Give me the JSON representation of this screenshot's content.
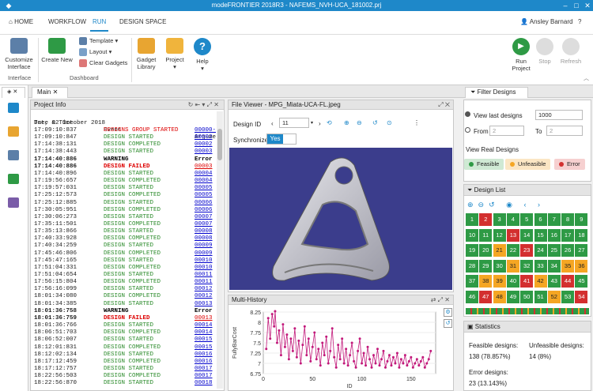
{
  "title": "modeFRONTIER 2018R3 - NAFEMS_NVH-UCA_181002.prj",
  "menu": {
    "home": "HOME",
    "workflow": "WORKFLOW",
    "run": "RUN",
    "design_space": "DESIGN SPACE",
    "user": "Ansley Barnard"
  },
  "ribbon": {
    "customize": "Customize Interface",
    "interface_group": "Interface",
    "create_new": "Create New",
    "template": "Template",
    "layout": "Layout",
    "clear_gadgets": "Clear Gadgets",
    "dashboard_group": "Dashboard",
    "gadget_library": "Gadget Library",
    "project": "Project",
    "help": "Help",
    "run_project": "Run Project",
    "stop": "Stop",
    "refresh": "Refresh"
  },
  "tabs": {
    "main": "Main"
  },
  "project_info": {
    "title": "Project Info",
    "headers": {
      "date": "Date & Time",
      "event": "Event",
      "arg": "Argumen"
    },
    "date_line": "Tue, 02 October 2018",
    "rows": [
      {
        "t": "17:09:10:837",
        "e": "DESIGNS GROUP STARTED",
        "a": "00000-0",
        "k": "group"
      },
      {
        "t": "17:09:10:847",
        "e": "DESIGN STARTED",
        "a": "00002",
        "k": "started"
      },
      {
        "t": "17:14:38:131",
        "e": "DESIGN COMPLETED",
        "a": "00002",
        "k": "completed"
      },
      {
        "t": "17:14:38:443",
        "e": "DESIGN STARTED",
        "a": "00003",
        "k": "started"
      },
      {
        "t": "17:14:40:886",
        "e": "WARNING",
        "a": "Error I",
        "k": "warning"
      },
      {
        "t": "17:14:40:886",
        "e": "DESIGN FAILED",
        "a": "00003",
        "k": "failed"
      },
      {
        "t": "17:14:40:896",
        "e": "DESIGN STARTED",
        "a": "00004",
        "k": "started"
      },
      {
        "t": "17:19:56:657",
        "e": "DESIGN COMPLETED",
        "a": "00004",
        "k": "completed"
      },
      {
        "t": "17:19:57:031",
        "e": "DESIGN STARTED",
        "a": "00005",
        "k": "started"
      },
      {
        "t": "17:25:12:573",
        "e": "DESIGN COMPLETED",
        "a": "00005",
        "k": "completed"
      },
      {
        "t": "17:25:12:885",
        "e": "DESIGN STARTED",
        "a": "00006",
        "k": "started"
      },
      {
        "t": "17:30:05:951",
        "e": "DESIGN COMPLETED",
        "a": "00006",
        "k": "completed"
      },
      {
        "t": "17:30:06:273",
        "e": "DESIGN STARTED",
        "a": "00007",
        "k": "started"
      },
      {
        "t": "17:35:11:501",
        "e": "DESIGN COMPLETED",
        "a": "00007",
        "k": "completed"
      },
      {
        "t": "17:35:13:866",
        "e": "DESIGN STARTED",
        "a": "00008",
        "k": "started"
      },
      {
        "t": "17:40:33:928",
        "e": "DESIGN COMPLETED",
        "a": "00008",
        "k": "completed"
      },
      {
        "t": "17:40:34:259",
        "e": "DESIGN STARTED",
        "a": "00009",
        "k": "started"
      },
      {
        "t": "17:45:46:806",
        "e": "DESIGN COMPLETED",
        "a": "00009",
        "k": "completed"
      },
      {
        "t": "17:45:47:165",
        "e": "DESIGN STARTED",
        "a": "00010",
        "k": "started"
      },
      {
        "t": "17:51:04:331",
        "e": "DESIGN COMPLETED",
        "a": "00010",
        "k": "completed"
      },
      {
        "t": "17:51:04:654",
        "e": "DESIGN STARTED",
        "a": "00011",
        "k": "started"
      },
      {
        "t": "17:56:15:804",
        "e": "DESIGN COMPLETED",
        "a": "00011",
        "k": "completed"
      },
      {
        "t": "17:56:16:099",
        "e": "DESIGN STARTED",
        "a": "00012",
        "k": "started"
      },
      {
        "t": "18:01:34:080",
        "e": "DESIGN COMPLETED",
        "a": "00012",
        "k": "completed"
      },
      {
        "t": "18:01:34:385",
        "e": "DESIGN STARTED",
        "a": "00013",
        "k": "started"
      },
      {
        "t": "18:01:36:758",
        "e": "WARNING",
        "a": "Error I",
        "k": "warning"
      },
      {
        "t": "18:01:36:759",
        "e": "DESIGN FAILED",
        "a": "00013",
        "k": "failed"
      },
      {
        "t": "18:01:36:766",
        "e": "DESIGN STARTED",
        "a": "00014",
        "k": "started"
      },
      {
        "t": "18:06:51:703",
        "e": "DESIGN COMPLETED",
        "a": "00014",
        "k": "completed"
      },
      {
        "t": "18:06:52:007",
        "e": "DESIGN STARTED",
        "a": "00015",
        "k": "started"
      },
      {
        "t": "18:12:01:831",
        "e": "DESIGN COMPLETED",
        "a": "00015",
        "k": "completed"
      },
      {
        "t": "18:12:02:134",
        "e": "DESIGN STARTED",
        "a": "00016",
        "k": "started"
      },
      {
        "t": "18:17:12:459",
        "e": "DESIGN COMPLETED",
        "a": "00016",
        "k": "completed"
      },
      {
        "t": "18:17:12:757",
        "e": "DESIGN STARTED",
        "a": "00017",
        "k": "started"
      },
      {
        "t": "18:22:56:503",
        "e": "DESIGN COMPLETED",
        "a": "00017",
        "k": "completed"
      },
      {
        "t": "18:22:56:870",
        "e": "DESIGN STARTED",
        "a": "00018",
        "k": "started"
      }
    ]
  },
  "file_viewer": {
    "title": "File Viewer - MPG_Miata-UCA-FL.jpeg",
    "design_id_label": "Design ID",
    "design_id": "11",
    "sync_label": "Synchronize",
    "sync_value": "Yes"
  },
  "multi_history": {
    "title": "Multi-History"
  },
  "chart_data": {
    "type": "line",
    "ylabel": "FullyBarCost",
    "xlabel": "ID",
    "ylim": [
      6.75,
      8.25
    ],
    "xlim": [
      0,
      175
    ],
    "yticks": [
      "8.25",
      "8",
      "7.75",
      "7.5",
      "7.25",
      "7",
      "6.75"
    ],
    "xticks": [
      "0",
      "50",
      "100",
      "150"
    ],
    "series": [
      {
        "values": [
          [
            3,
            7.35
          ],
          [
            5,
            8.1
          ],
          [
            7,
            7.6
          ],
          [
            9,
            8.2
          ],
          [
            11,
            7.9
          ],
          [
            12,
            8.27
          ],
          [
            14,
            7.5
          ],
          [
            16,
            7.8
          ],
          [
            18,
            7.2
          ],
          [
            20,
            7.95
          ],
          [
            22,
            7.4
          ],
          [
            24,
            7.7
          ],
          [
            26,
            7.1
          ],
          [
            28,
            7.6
          ],
          [
            30,
            7.3
          ],
          [
            32,
            7.85
          ],
          [
            34,
            7.15
          ],
          [
            36,
            7.55
          ],
          [
            38,
            7.0
          ],
          [
            40,
            7.45
          ],
          [
            42,
            7.9
          ],
          [
            44,
            7.2
          ],
          [
            46,
            7.6
          ],
          [
            48,
            7.05
          ],
          [
            50,
            7.4
          ],
          [
            52,
            7.75
          ],
          [
            54,
            7.1
          ],
          [
            56,
            7.35
          ],
          [
            58,
            6.95
          ],
          [
            60,
            7.5
          ],
          [
            62,
            7.2
          ],
          [
            64,
            7.65
          ],
          [
            66,
            7.0
          ],
          [
            68,
            7.3
          ],
          [
            70,
            7.85
          ],
          [
            72,
            7.15
          ],
          [
            74,
            6.9
          ],
          [
            76,
            7.45
          ],
          [
            78,
            7.1
          ],
          [
            80,
            7.6
          ],
          [
            82,
            7.0
          ],
          [
            84,
            7.35
          ],
          [
            86,
            6.95
          ],
          [
            88,
            7.2
          ],
          [
            90,
            7.5
          ],
          [
            92,
            7.05
          ],
          [
            94,
            6.9
          ],
          [
            96,
            7.3
          ],
          [
            98,
            7.6
          ],
          [
            100,
            7.0
          ],
          [
            102,
            7.25
          ],
          [
            104,
            6.95
          ],
          [
            106,
            7.4
          ],
          [
            108,
            7.1
          ],
          [
            110,
            6.9
          ],
          [
            112,
            7.2
          ],
          [
            114,
            7.0
          ],
          [
            116,
            7.35
          ],
          [
            118,
            6.95
          ],
          [
            120,
            7.1
          ],
          [
            122,
            7.3
          ],
          [
            124,
            6.9
          ],
          [
            126,
            7.05
          ],
          [
            128,
            7.2
          ],
          [
            130,
            6.95
          ],
          [
            132,
            7.15
          ],
          [
            134,
            7.0
          ],
          [
            136,
            7.25
          ],
          [
            138,
            6.9
          ],
          [
            140,
            7.1
          ],
          [
            142,
            7.0
          ],
          [
            144,
            7.2
          ],
          [
            146,
            6.95
          ],
          [
            148,
            7.05
          ],
          [
            150,
            7.15
          ],
          [
            152,
            6.9
          ],
          [
            154,
            7.0
          ],
          [
            156,
            7.1
          ],
          [
            158,
            6.95
          ],
          [
            160,
            7.05
          ],
          [
            162,
            7.15
          ],
          [
            164,
            6.9
          ],
          [
            166,
            7.0
          ],
          [
            168,
            7.1
          ],
          [
            170,
            7.3
          ]
        ]
      }
    ]
  },
  "filter": {
    "title": "Filter Designs",
    "view_last": "View last designs",
    "view_last_value": "1000",
    "from": "From",
    "from_value": "2",
    "to": "To",
    "to_value": "2",
    "view_real": "View Real Designs",
    "feasible": "Feasible",
    "unfeasible": "Unfeasible",
    "error": "Error"
  },
  "design_list": {
    "title": "Design List",
    "cells": [
      [
        "1",
        "2",
        "3",
        "4",
        "5",
        "6",
        "7",
        "8",
        "9"
      ],
      [
        "10",
        "11",
        "12",
        "13",
        "14",
        "15",
        "16",
        "17",
        "18"
      ],
      [
        "19",
        "20",
        "21",
        "22",
        "23",
        "24",
        "25",
        "26",
        "27"
      ],
      [
        "28",
        "29",
        "30",
        "31",
        "32",
        "33",
        "34",
        "35",
        "36"
      ],
      [
        "37",
        "38",
        "39",
        "40",
        "41",
        "42",
        "43",
        "44",
        "45"
      ],
      [
        "46",
        "47",
        "48",
        "49",
        "50",
        "51",
        "52",
        "53",
        "54"
      ]
    ],
    "status": [
      [
        "g",
        "r",
        "g",
        "g",
        "g",
        "g",
        "g",
        "g",
        "g"
      ],
      [
        "g",
        "g",
        "g",
        "r",
        "g",
        "g",
        "g",
        "g",
        "g"
      ],
      [
        "g",
        "g",
        "o",
        "g",
        "r",
        "g",
        "g",
        "g",
        "g"
      ],
      [
        "g",
        "g",
        "g",
        "o",
        "g",
        "g",
        "g",
        "o",
        "o"
      ],
      [
        "g",
        "o",
        "o",
        "g",
        "r",
        "o",
        "g",
        "r",
        "g"
      ],
      [
        "g",
        "r",
        "o",
        "g",
        "g",
        "g",
        "o",
        "g",
        "r"
      ]
    ],
    "labels_row5": [
      "34",
      "35",
      "36",
      "37",
      "38",
      "39",
      "40",
      "41"
    ]
  },
  "statistics": {
    "title": "Statistics",
    "feasible_label": "Feasible designs:",
    "feasible_value": "138 (78.857%)",
    "unfeasible_label": "Unfeasible designs:",
    "unfeasible_value": "14 (8%)",
    "error_label": "Error designs:",
    "error_value": "23 (13.143%)"
  },
  "colors": {
    "accent": "#1e88c9",
    "feasible": "#2e9a45",
    "unfeasible": "#f5a623",
    "error": "#d32f2f",
    "chart_line": "#c2187a",
    "viewer_bg": "#3b3d8c"
  }
}
